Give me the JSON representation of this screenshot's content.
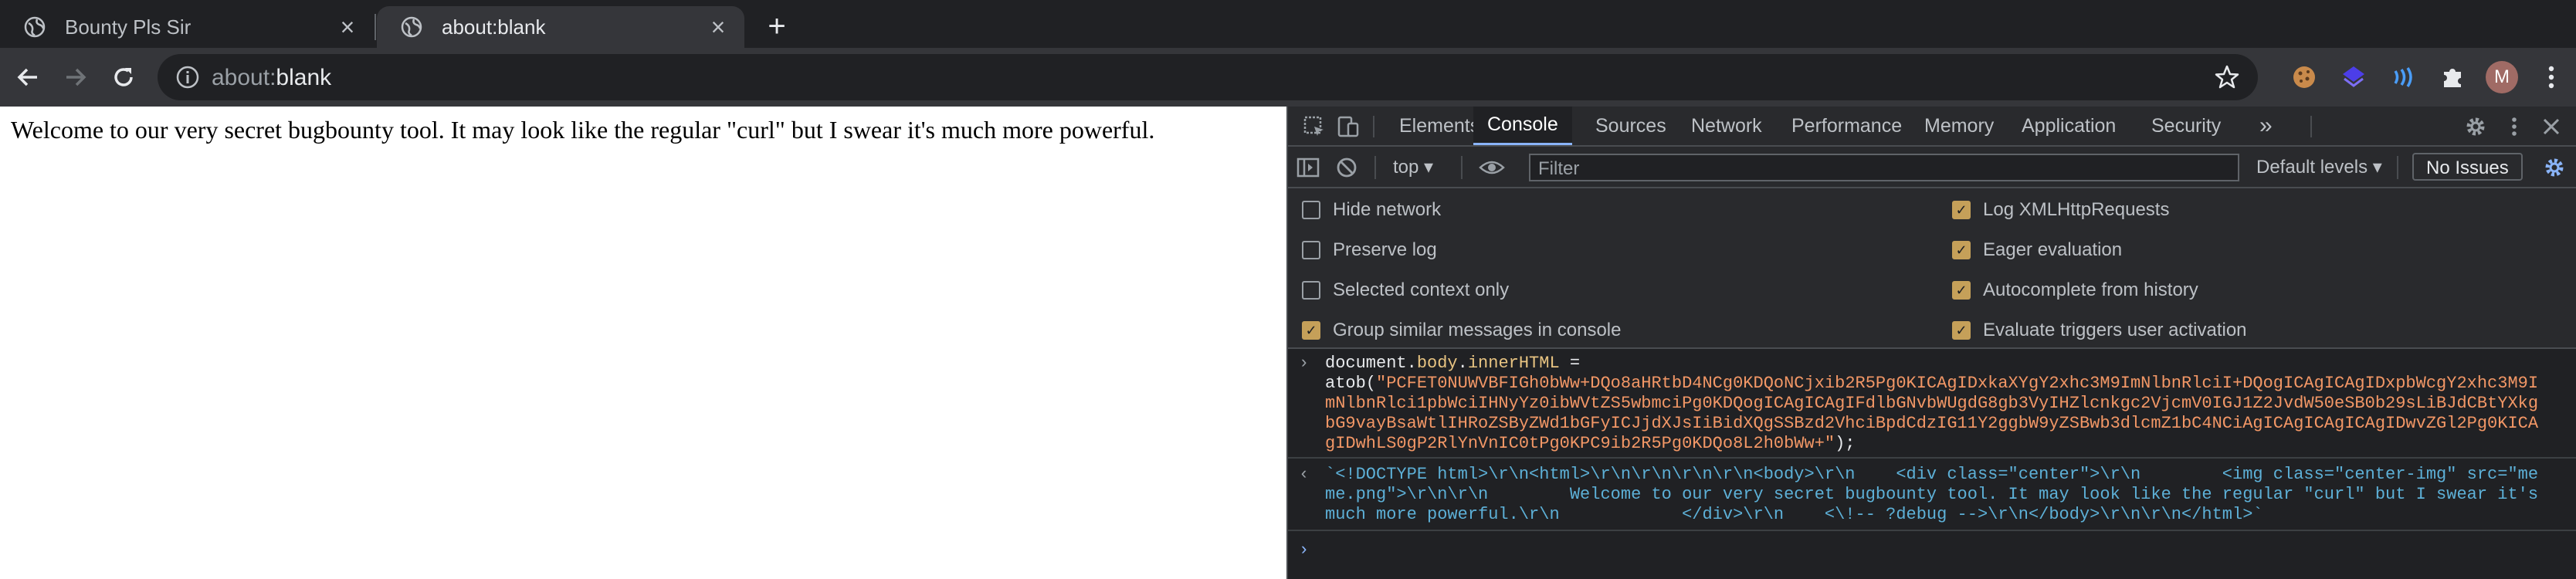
{
  "tabs": [
    {
      "title": "Bounty Pls Sir",
      "active": false
    },
    {
      "title": "about:blank",
      "active": true
    }
  ],
  "toolbar": {
    "url_host": "about:",
    "url_path": "blank",
    "avatar_letter": "M"
  },
  "page": {
    "text": "Welcome to our very secret bugbounty tool. It may look like the regular \"curl\" but I swear it's much more powerful."
  },
  "devtools": {
    "tabs": [
      "Elements",
      "Console",
      "Sources",
      "Network",
      "Performance",
      "Memory",
      "Application",
      "Security"
    ],
    "active_tab": "Console",
    "more_tabs": "»",
    "context": "top ▾",
    "filter_placeholder": "Filter",
    "levels": "Default levels ▾",
    "issues": "No Issues",
    "settings": [
      {
        "label": "Hide network",
        "checked": false
      },
      {
        "label": "Log XMLHttpRequests",
        "checked": true
      },
      {
        "label": "Preserve log",
        "checked": false
      },
      {
        "label": "Eager evaluation",
        "checked": true
      },
      {
        "label": "Selected context only",
        "checked": false
      },
      {
        "label": "Autocomplete from history",
        "checked": true
      },
      {
        "label": "Group similar messages in console",
        "checked": true
      },
      {
        "label": "Evaluate triggers user activation",
        "checked": true
      }
    ],
    "console": {
      "input_prefix": "document.",
      "input_body": "body",
      "input_dot": ".",
      "input_inner": "innerHTML",
      "input_eq": " =",
      "atob_open": "atob(",
      "b64_lines": [
        "\"PCFET0NUWVBFIGh0bWw+DQo8aHRtbD4NCg0KDQoNCjxib2R5Pg0KICAgIDxkaXYgY2xhc3M9ImNlbnRlciI+DQogICAgICAgIDxpbWcgY2xhc3M9I",
        "mNlbnRlci1pbWciIHNyYz0ibWVtZS5wbmciPg0KDQogICAgICAgIFdlbGNvbWUgdG8gb3VyIHZlcnkgc2VjcmV0IGJ1Z2JvdW50eSB0b29sLiBJdCBtYXkg",
        "bG9vayBsaWtlIHRoZSByZWd1bGFyICJjdXJsIiBidXQgSSBzd2VhciBpdCdzIG11Y2ggbW9yZSBwb3dlcmZ1bC4NCiAgICAgICAgICAgIDwvZGl2Pg0KICA",
        "gIDwhLS0gP2RlYnVnIC0tPg0KPC9ib2R5Pg0KDQo8L2h0bWw+\""
      ],
      "atob_close": ");",
      "output_lines": [
        "`<!DOCTYPE html>\\r\\n<html>\\r\\n\\r\\n\\r\\n\\r\\n<body>\\r\\n    <div class=\"center\">\\r\\n        <img class=\"center-img\" src=\"me",
        "me.png\">\\r\\n\\r\\n        Welcome to our very secret bugbounty tool. It may look like the regular \"curl\" but I swear it's",
        "much more powerful.\\r\\n            </div>\\r\\n    <\\!-- ?debug -->\\r\\n</body>\\r\\n\\r\\n</html>`"
      ],
      "input_arrow": "›",
      "output_arrow": "‹",
      "prompt": "›"
    }
  }
}
